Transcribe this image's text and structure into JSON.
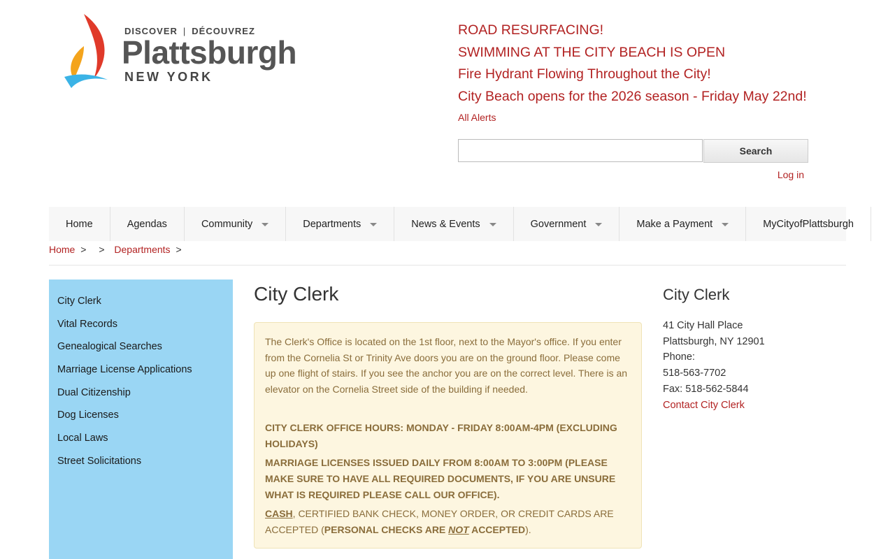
{
  "logo": {
    "discover": "DISCOVER",
    "decouvrez": "DÉCOUVREZ",
    "name": "Plattsburgh",
    "state": "NEW YORK"
  },
  "alerts": {
    "items": [
      "ROAD RESURFACING!",
      "SWIMMING AT THE CITY BEACH IS OPEN",
      "Fire Hydrant Flowing Throughout the City!",
      "City Beach opens for the 2026 season - Friday May 22nd!"
    ],
    "all_label": "All Alerts"
  },
  "search": {
    "placeholder": "",
    "button_label": "Search"
  },
  "login_label": "Log in",
  "nav": [
    {
      "label": "Home"
    },
    {
      "label": "Agendas"
    },
    {
      "label": "Community"
    },
    {
      "label": "Departments"
    },
    {
      "label": "News & Events"
    },
    {
      "label": "Government"
    },
    {
      "label": "Make a Payment"
    },
    {
      "label": "MyCityofPlattsburgh"
    }
  ],
  "breadcrumb": {
    "home": "Home",
    "sep": ">",
    "departments": "Departments"
  },
  "sidebar": [
    "City Clerk",
    "Vital Records",
    "Genealogical Searches",
    "Marriage License Applications",
    "Dual Citizenship",
    "Dog Licenses",
    "Local Laws",
    "Street Solicitations"
  ],
  "main": {
    "title": "City Clerk",
    "intro": "The Clerk's Office is located on the 1st floor, next to the Mayor's office. If you enter from the Cornelia St or Trinity Ave doors you are on the ground floor. Please come up one flight of stairs. If you see the anchor you are on the correct level. There is an elevator on the Cornelia Street side of the building if needed.",
    "hours": "CITY CLERK OFFICE HOURS: MONDAY - FRIDAY  8:00AM-4PM  (EXCLUDING HOLIDAYS)",
    "marriage": "MARRIAGE LICENSES ISSUED DAILY FROM 8:00AM TO 3:00PM (PLEASE MAKE SURE TO HAVE ALL REQUIRED DOCUMENTS, IF YOU ARE UNSURE WHAT IS REQUIRED PLEASE CALL OUR OFFICE).",
    "payment": {
      "cash": "CASH",
      "rest": ", CERTIFIED BANK CHECK, MONEY ORDER, OR CREDIT CARDS ARE ACCEPTED (",
      "personal": "PERSONAL CHECKS ARE ",
      "not": "NOT",
      "accepted": " ACCEPTED",
      "close": ")."
    }
  },
  "contact": {
    "title": "City Clerk",
    "address1": "41 City Hall Place",
    "address2": "Plattsburgh, NY 12901",
    "phone_label": "Phone:",
    "phone": "518-563-7702",
    "fax": "Fax: 518-562-5844",
    "link": "Contact City Clerk"
  },
  "colors": {
    "accent": "#b22222",
    "sidebar_bg": "#9ad6f4",
    "info_bg": "#fdf6e0",
    "info_text": "#8a6d3b"
  }
}
